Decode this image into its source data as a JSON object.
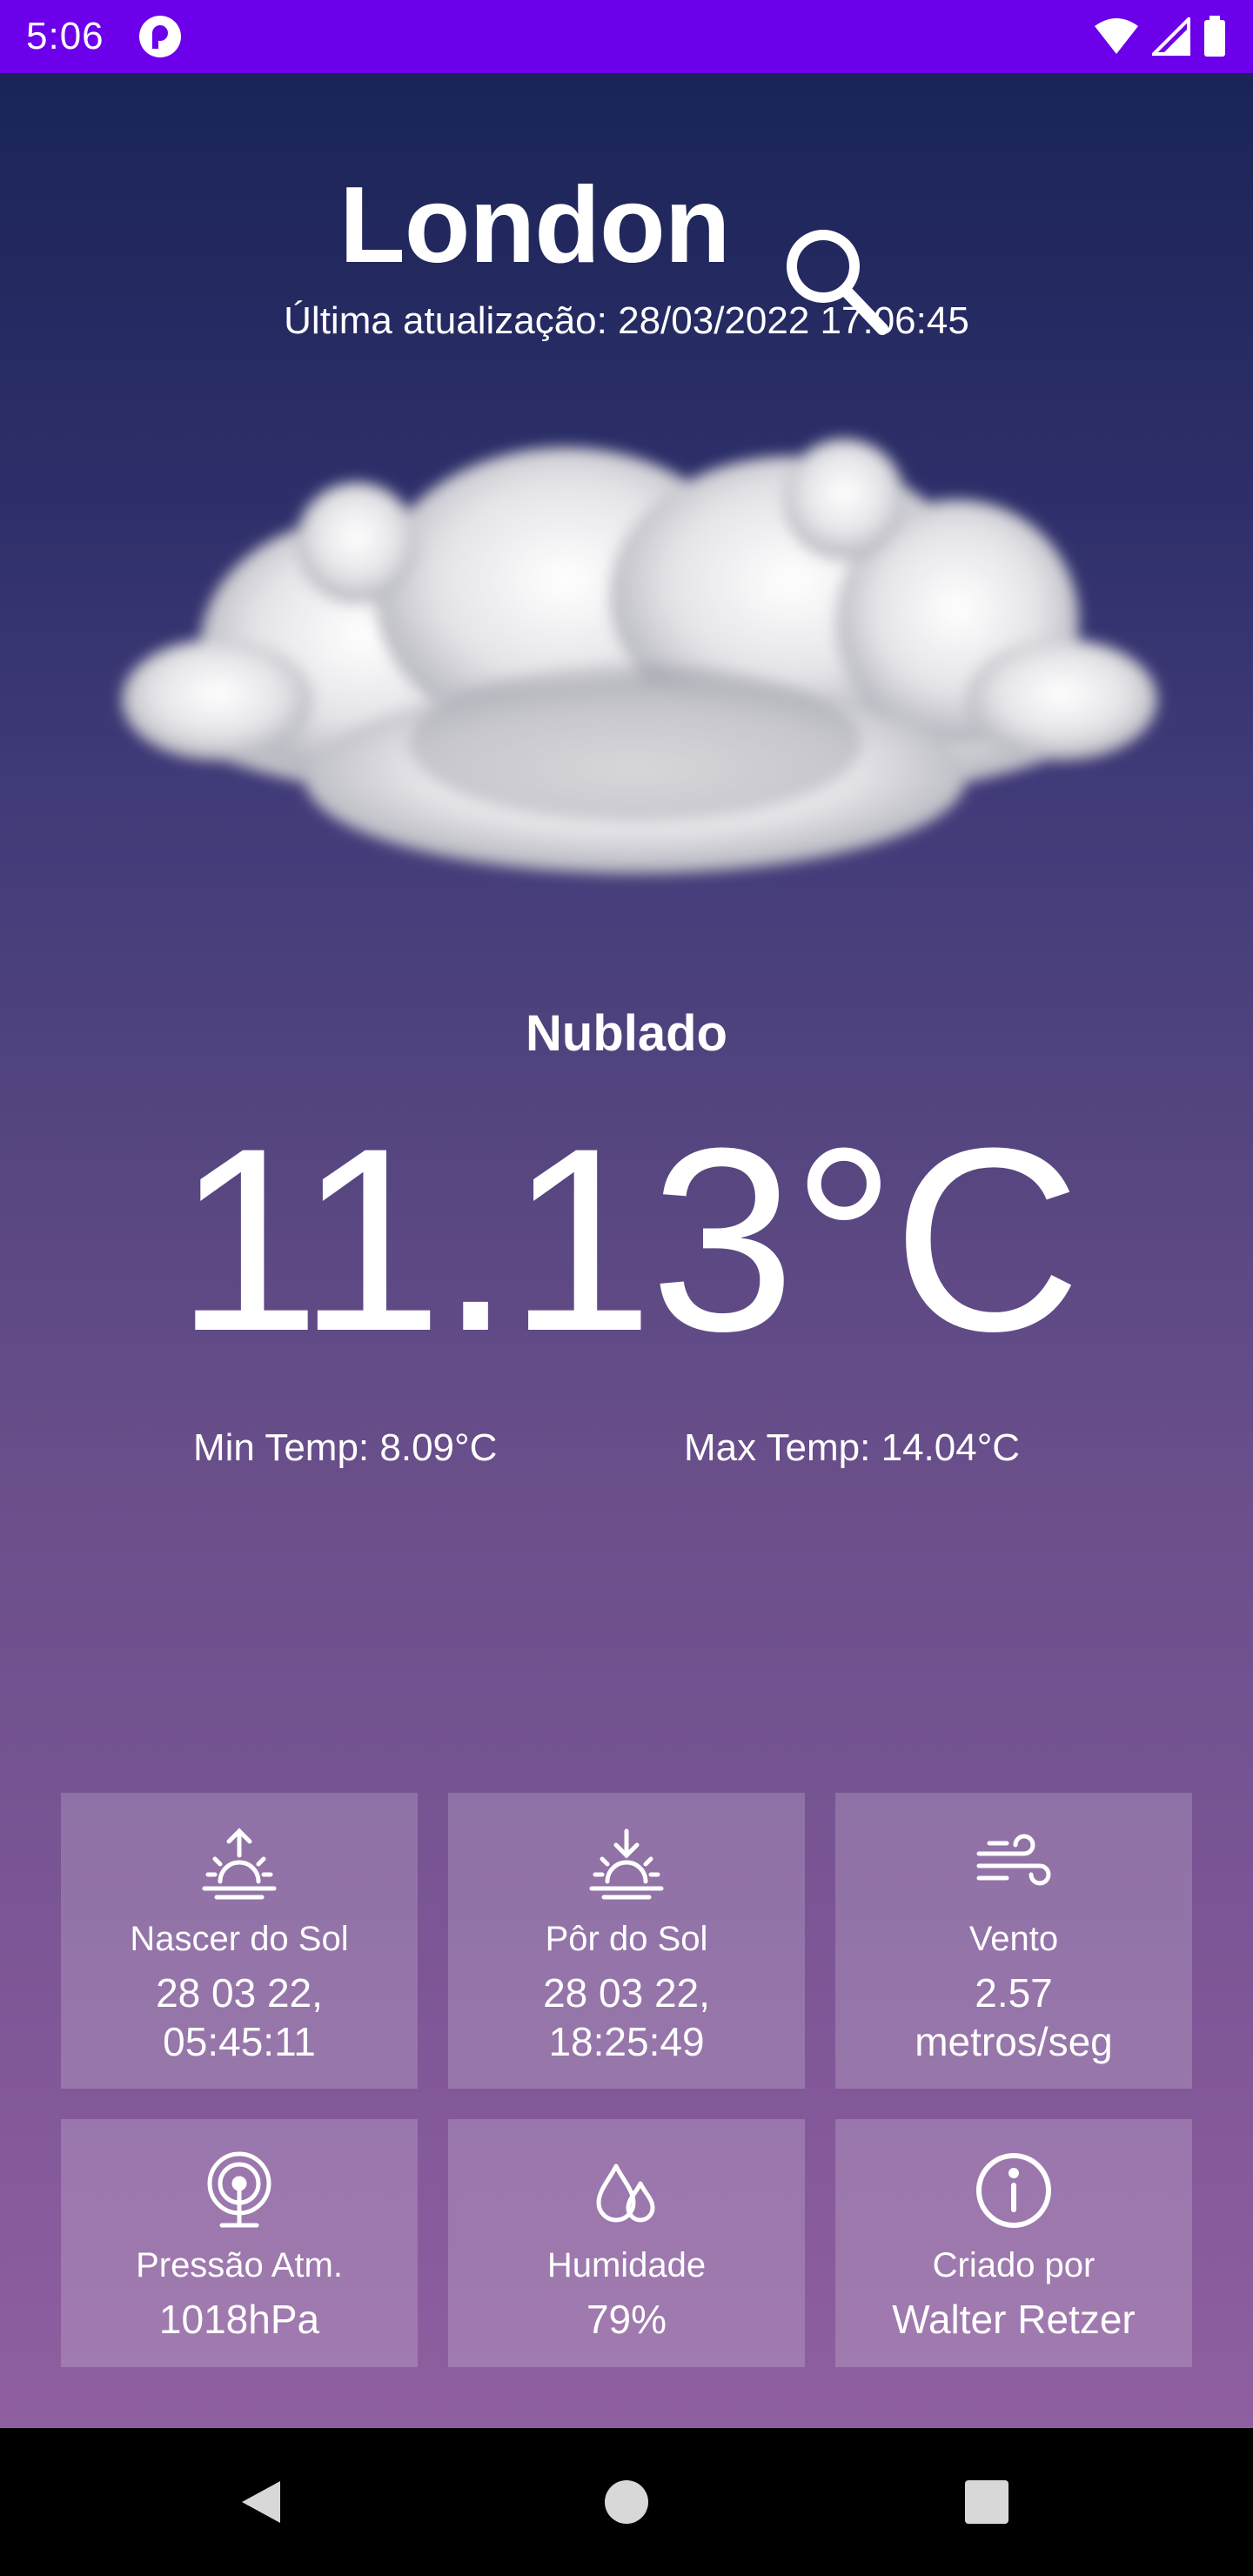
{
  "status_bar": {
    "time": "5:06",
    "color": "#6c00ea"
  },
  "header": {
    "city": "London",
    "search_icon": "search-icon",
    "last_updated": "Última atualização: 28/03/2022 17:06:45"
  },
  "weather": {
    "icon": "cloud-icon",
    "condition": "Nublado",
    "temperature": "11.13°C",
    "min_temp": "Min Temp: 8.09°C",
    "max_temp": "Max Temp: 14.04°C"
  },
  "cards": [
    {
      "icon": "sunrise-icon",
      "label": "Nascer do Sol",
      "value_line1": "28 03 22,",
      "value_line2": "05:45:11"
    },
    {
      "icon": "sunset-icon",
      "label": "Pôr do Sol",
      "value_line1": "28 03 22,",
      "value_line2": "18:25:49"
    },
    {
      "icon": "wind-icon",
      "label": "Vento",
      "value_line1": "2.57",
      "value_line2": "metros/seg"
    },
    {
      "icon": "pressure-icon",
      "label": "Pressão Atm.",
      "value_line1": "1018hPa"
    },
    {
      "icon": "humidity-icon",
      "label": "Humidade",
      "value_line1": "79%"
    },
    {
      "icon": "info-icon",
      "label": "Criado por",
      "value_line1": "Walter Retzer"
    }
  ],
  "nav": {
    "back": "back-icon",
    "home": "home-icon",
    "recents": "recents-icon"
  }
}
